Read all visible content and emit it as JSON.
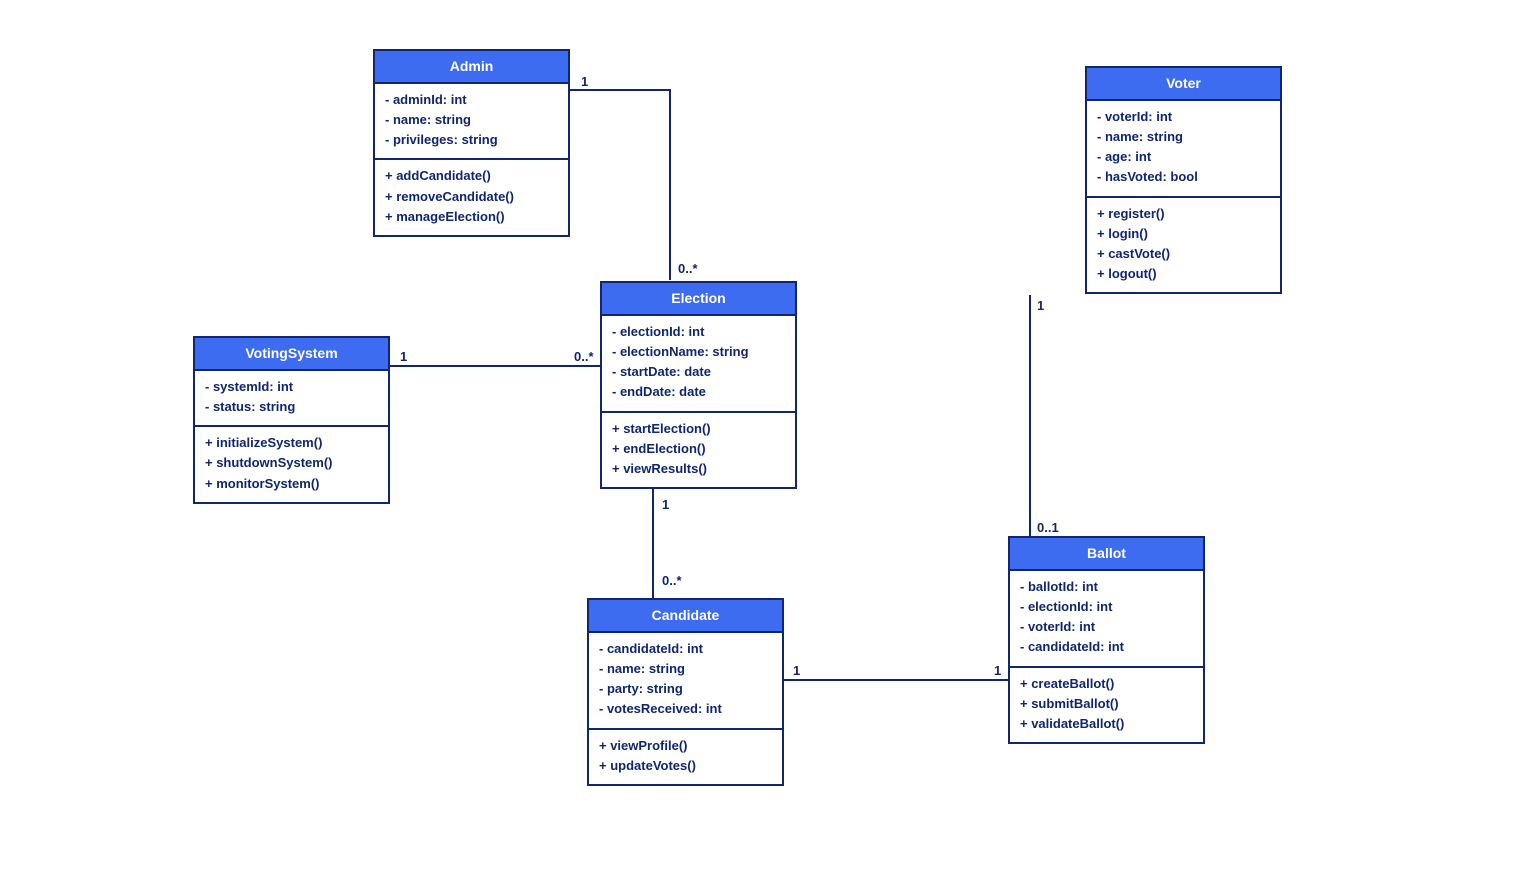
{
  "classes": {
    "admin": {
      "name": "Admin",
      "attrs": [
        "- adminId: int",
        "- name: string",
        "- privileges: string"
      ],
      "ops": [
        "+ addCandidate()",
        "+ removeCandidate()",
        "+ manageElection()"
      ]
    },
    "voter": {
      "name": "Voter",
      "attrs": [
        "- voterId: int",
        "- name: string",
        "- age: int",
        "- hasVoted: bool"
      ],
      "ops": [
        "+ register()",
        "+ login()",
        "+ castVote()",
        "+ logout()"
      ]
    },
    "votingsystem": {
      "name": "VotingSystem",
      "attrs": [
        "- systemId: int",
        "- status: string"
      ],
      "ops": [
        "+ initializeSystem()",
        "+ shutdownSystem()",
        "+ monitorSystem()"
      ]
    },
    "election": {
      "name": "Election",
      "attrs": [
        "- electionId: int",
        "- electionName: string",
        "- startDate: date",
        "- endDate: date"
      ],
      "ops": [
        "+ startElection()",
        "+ endElection()",
        "+ viewResults()"
      ]
    },
    "candidate": {
      "name": "Candidate",
      "attrs": [
        "- candidateId: int",
        "- name: string",
        "- party: string",
        "- votesReceived: int"
      ],
      "ops": [
        "+ viewProfile()",
        "+ updateVotes()"
      ]
    },
    "ballot": {
      "name": "Ballot",
      "attrs": [
        "- ballotId: int",
        "- electionId: int",
        "- voterId: int",
        "- candidateId: int"
      ],
      "ops": [
        "+ createBallot()",
        "+ submitBallot()",
        "+ validateBallot()"
      ]
    }
  },
  "mult": {
    "admin_elec_a": "1",
    "admin_elec_b": "0..*",
    "vs_elec_a": "1",
    "vs_elec_b": "0..*",
    "elec_cand_a": "1",
    "elec_cand_b": "0..*",
    "cand_ballot_a": "1",
    "cand_ballot_b": "1",
    "voter_ballot_a": "1",
    "voter_ballot_b": "0..1"
  }
}
